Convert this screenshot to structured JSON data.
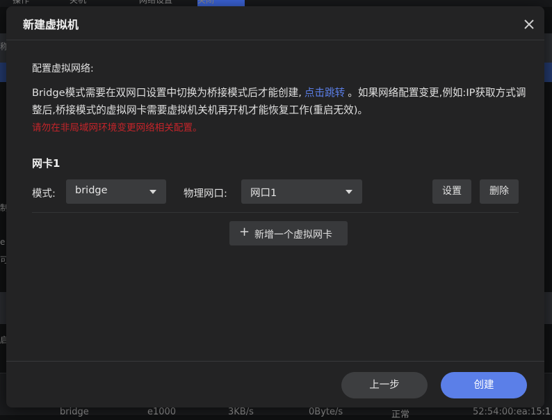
{
  "background": {
    "tabs": [
      "操作",
      "关机",
      "",
      "网络设置",
      "关闭"
    ],
    "table_row": [
      "bridge",
      "e1000",
      "3KB/s",
      "0Byte/s",
      "正常",
      "52:54:00:ea:15:1"
    ],
    "left_fragments": [
      "称",
      "启",
      "e",
      "可",
      "启",
      "制"
    ]
  },
  "dialog": {
    "title": "新建虚拟机",
    "close_icon": "close-icon",
    "section_label": "配置虚拟网络:",
    "desc_part1": "Bridge模式需要在双网口设置中切换为桥接模式后才能创建,",
    "desc_link": "点击跳转",
    "desc_part2": "。如果网络配置变更,例如:IP获取方式调整后,桥接模式的虚拟网卡需要虚拟机关机再开机才能恢复工作(重启无效)。",
    "desc_warning": "请勿在非局域网环境变更网络相关配置。",
    "nic": {
      "title": "网卡1",
      "mode_label": "模式:",
      "mode_value": "bridge",
      "port_label": "物理网口:",
      "port_value": "网口1",
      "settings_button": "设置",
      "delete_button": "删除"
    },
    "add_nic_button": "新增一个虚拟网卡",
    "prev_button": "上一步",
    "create_button": "创建"
  },
  "colors": {
    "accent": "#5b7fe8",
    "warning": "#c4242a",
    "dialog_bg": "#232324"
  }
}
